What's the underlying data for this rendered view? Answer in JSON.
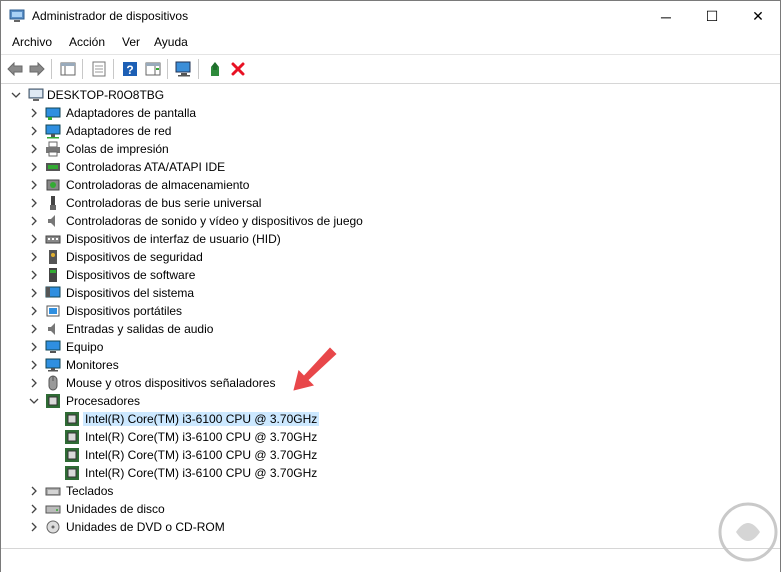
{
  "window": {
    "title": "Administrador de dispositivos",
    "controls": {
      "minimize": "─",
      "maximize": "☐",
      "close": "✕"
    }
  },
  "menu": {
    "items": [
      "Archivo",
      "Acción",
      "Ver",
      "Ayuda"
    ]
  },
  "toolbar": {
    "buttons": [
      "back-icon",
      "forward-icon",
      "properties-pane-icon",
      "console-tree-icon",
      "help-icon",
      "action-pane-icon",
      "computer-scan-icon",
      "update-driver-icon",
      "uninstall-icon"
    ]
  },
  "tree": {
    "root": "DESKTOP-R0O8TBG",
    "categories": [
      "Adaptadores de pantalla",
      "Adaptadores de red",
      "Colas de impresión",
      "Controladoras ATA/ATAPI IDE",
      "Controladoras de almacenamiento",
      "Controladoras de bus serie universal",
      "Controladoras de sonido y vídeo y dispositivos de juego",
      "Dispositivos de interfaz de usuario (HID)",
      "Dispositivos de seguridad",
      "Dispositivos de software",
      "Dispositivos del sistema",
      "Dispositivos portátiles",
      "Entradas y salidas de audio",
      "Equipo",
      "Monitores",
      "Mouse y otros dispositivos señaladores",
      "Procesadores"
    ],
    "processors": [
      "Intel(R) Core(TM) i3-6100 CPU @ 3.70GHz",
      "Intel(R) Core(TM) i3-6100 CPU @ 3.70GHz",
      "Intel(R) Core(TM) i3-6100 CPU @ 3.70GHz",
      "Intel(R) Core(TM) i3-6100 CPU @ 3.70GHz"
    ],
    "after": [
      "Teclados",
      "Unidades de disco",
      "Unidades de DVD o CD-ROM"
    ]
  },
  "colors": {
    "selection": "#cce8ff",
    "arrow": "#e8474a",
    "delete": "#e81123"
  }
}
